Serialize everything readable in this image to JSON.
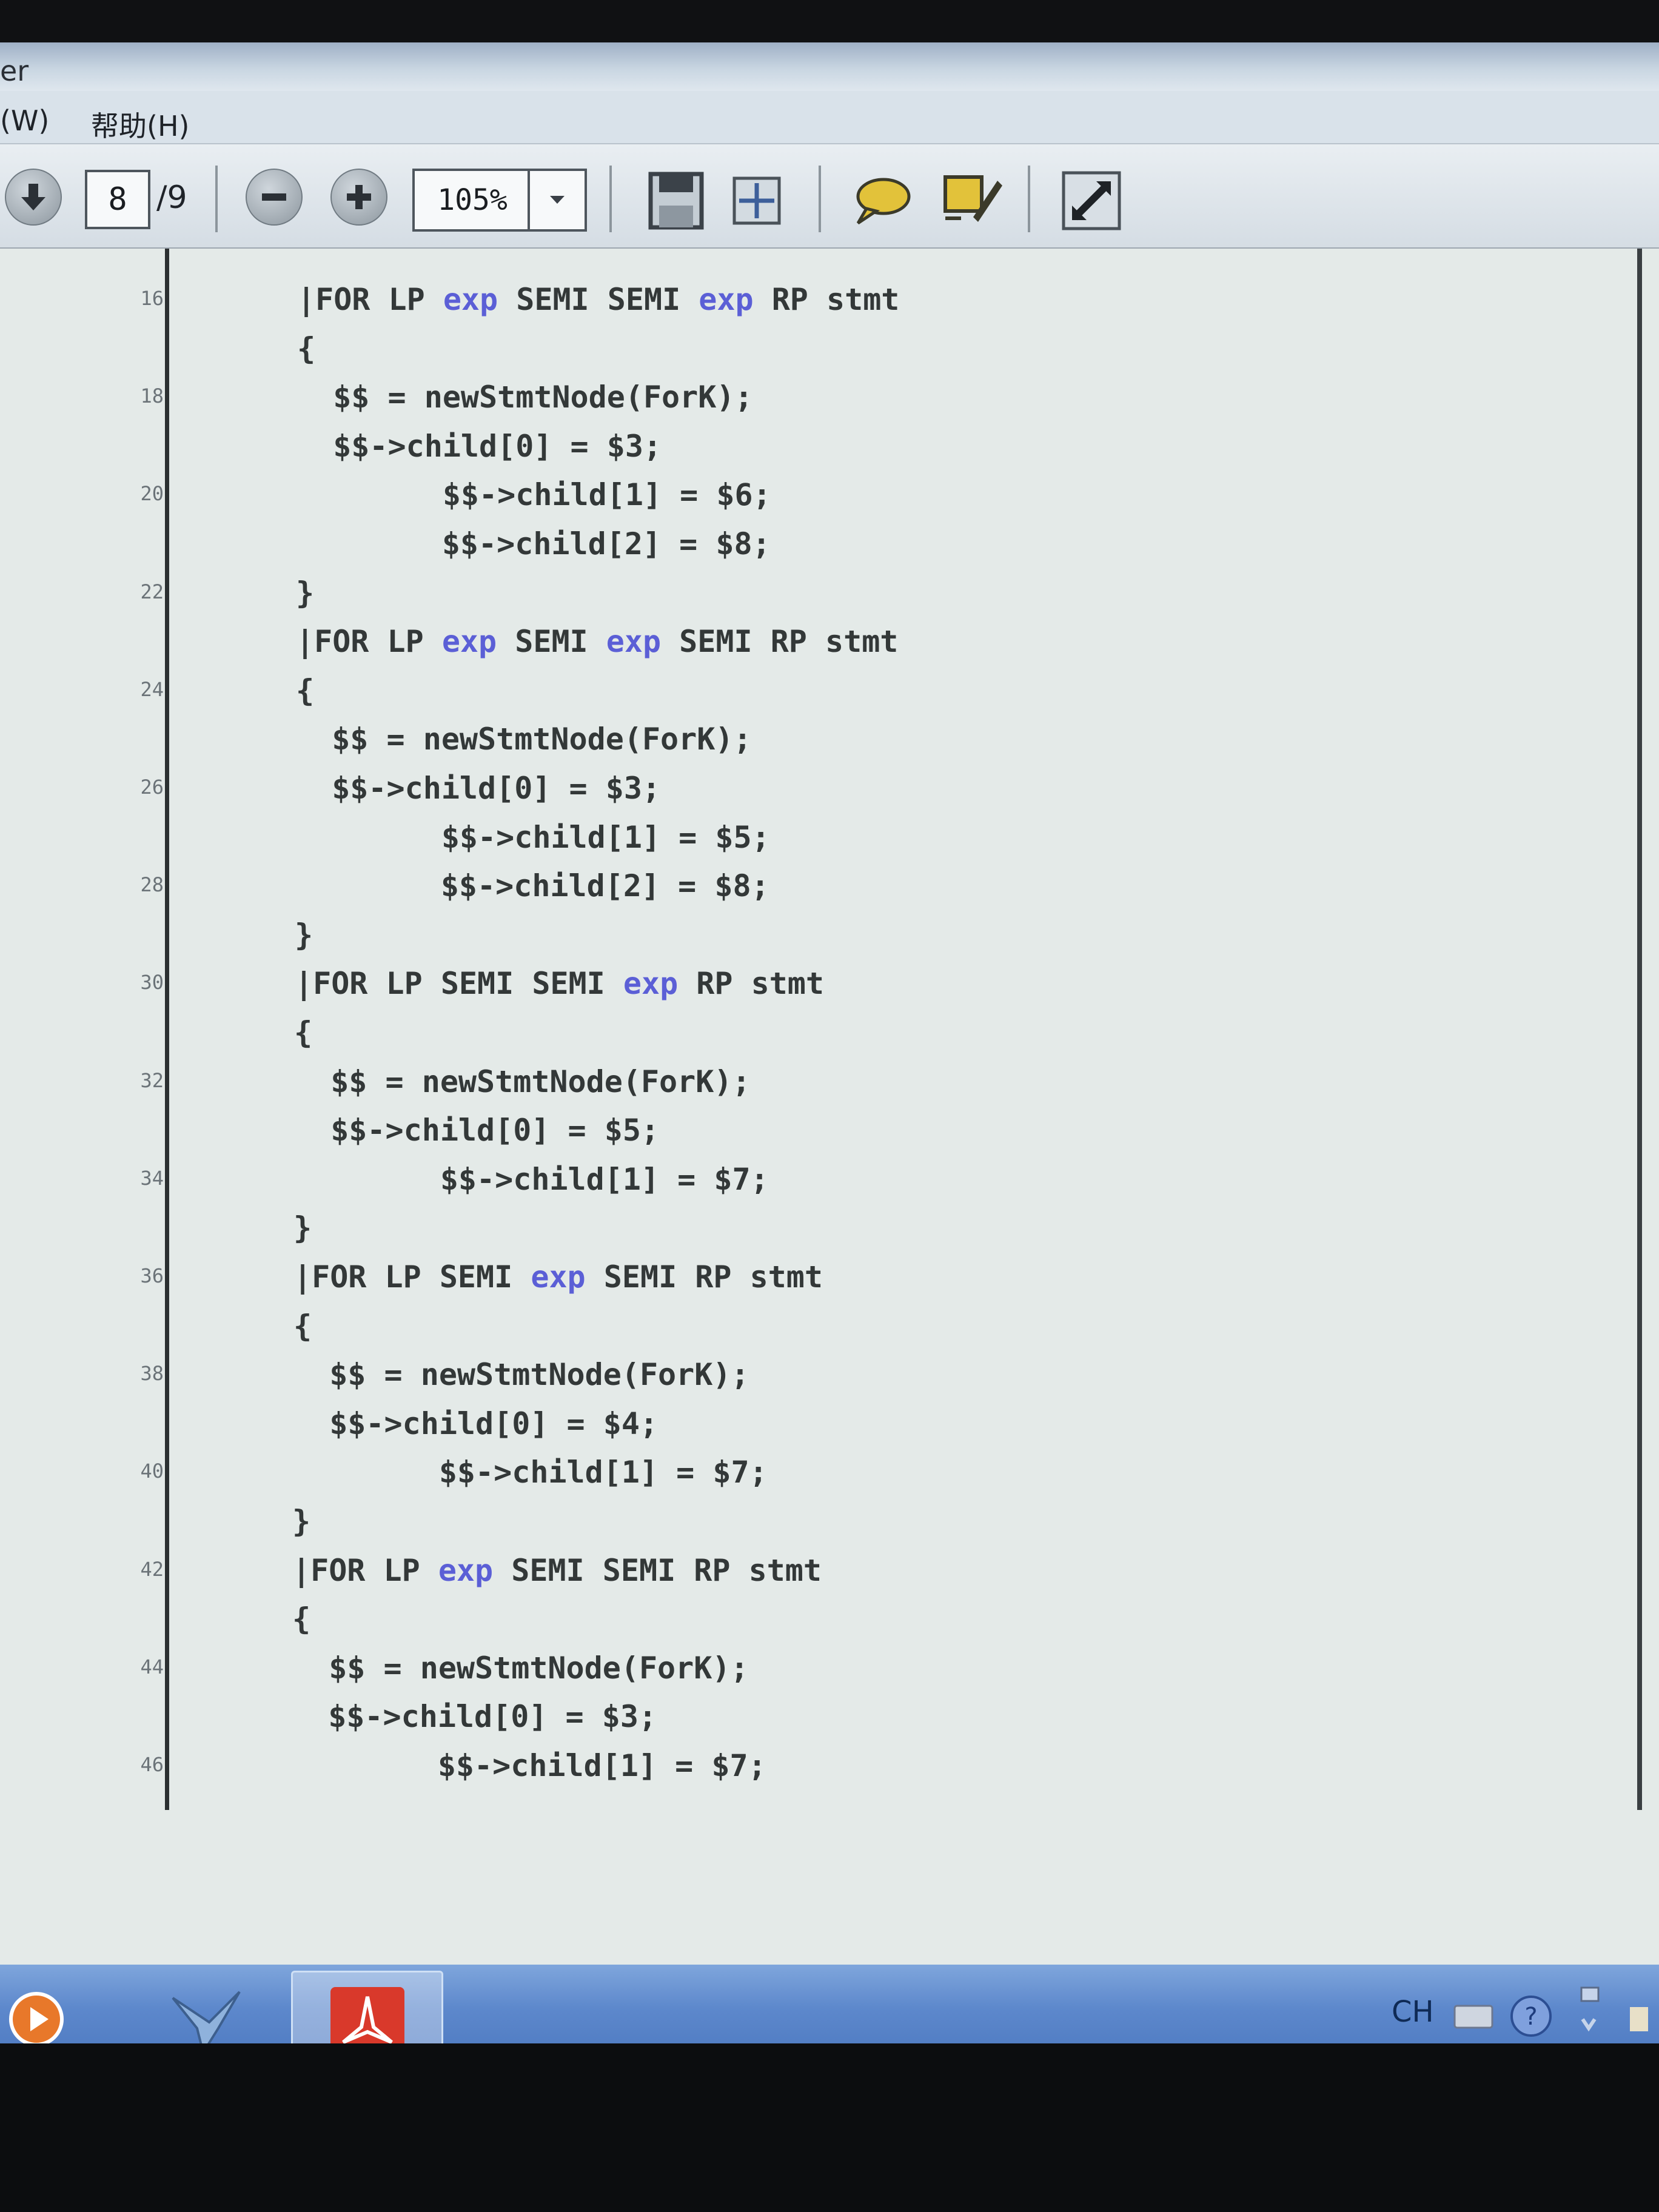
{
  "window": {
    "title_fragment": "er"
  },
  "menu": {
    "items": [
      "(W)",
      "帮助(H)"
    ]
  },
  "toolbar": {
    "page_current": "8",
    "page_total": "/9",
    "zoom": "105%",
    "icons": [
      "arrow-down-icon",
      "zoom-out-icon",
      "zoom-in-icon",
      "dropdown-icon",
      "fit-page-icon",
      "fit-width-icon",
      "comment-icon",
      "sign-icon",
      "expand-icon"
    ]
  },
  "document": {
    "keyword_color": "#5b5fd6",
    "line_numbers": [
      "16",
      "18",
      "20",
      "22",
      "24",
      "26",
      "28",
      "30",
      "32",
      "34",
      "36",
      "38",
      "40",
      "42",
      "44",
      "46"
    ],
    "lines": [
      [
        {
          "t": "|FOR LP "
        },
        {
          "t": "exp",
          "k": 1
        },
        {
          "t": " SEMI SEMI "
        },
        {
          "t": "exp",
          "k": 1
        },
        {
          "t": " RP stmt"
        }
      ],
      [
        {
          "t": "{"
        }
      ],
      [
        {
          "t": "  $$ = newStmtNode(ForK);"
        }
      ],
      [
        {
          "t": "  $$->child[0] = $3;"
        }
      ],
      [
        {
          "t": "        $$->child[1] = $6;"
        }
      ],
      [
        {
          "t": "        $$->child[2] = $8;"
        }
      ],
      [
        {
          "t": "}"
        }
      ],
      [
        {
          "t": "|FOR LP "
        },
        {
          "t": "exp",
          "k": 1
        },
        {
          "t": " SEMI "
        },
        {
          "t": "exp",
          "k": 1
        },
        {
          "t": " SEMI RP stmt"
        }
      ],
      [
        {
          "t": "{"
        }
      ],
      [
        {
          "t": "  $$ = newStmtNode(ForK);"
        }
      ],
      [
        {
          "t": "  $$->child[0] = $3;"
        }
      ],
      [
        {
          "t": "        $$->child[1] = $5;"
        }
      ],
      [
        {
          "t": "        $$->child[2] = $8;"
        }
      ],
      [
        {
          "t": "}"
        }
      ],
      [
        {
          "t": "|FOR LP SEMI SEMI "
        },
        {
          "t": "exp",
          "k": 1
        },
        {
          "t": " RP stmt"
        }
      ],
      [
        {
          "t": "{"
        }
      ],
      [
        {
          "t": "  $$ = newStmtNode(ForK);"
        }
      ],
      [
        {
          "t": "  $$->child[0] = $5;"
        }
      ],
      [
        {
          "t": "        $$->child[1] = $7;"
        }
      ],
      [
        {
          "t": "}"
        }
      ],
      [
        {
          "t": "|FOR LP SEMI "
        },
        {
          "t": "exp",
          "k": 1
        },
        {
          "t": " SEMI RP stmt"
        }
      ],
      [
        {
          "t": "{"
        }
      ],
      [
        {
          "t": "  $$ = newStmtNode(ForK);"
        }
      ],
      [
        {
          "t": "  $$->child[0] = $4;"
        }
      ],
      [
        {
          "t": "        $$->child[1] = $7;"
        }
      ],
      [
        {
          "t": "}"
        }
      ],
      [
        {
          "t": "|FOR LP "
        },
        {
          "t": "exp",
          "k": 1
        },
        {
          "t": " SEMI SEMI RP stmt"
        }
      ],
      [
        {
          "t": "{"
        }
      ],
      [
        {
          "t": "  $$ = newStmtNode(ForK);"
        }
      ],
      [
        {
          "t": "  $$->child[0] = $3;"
        }
      ],
      [
        {
          "t": "        $$->child[1] = $7;"
        }
      ]
    ]
  },
  "taskbar": {
    "apps": [
      "media-player-icon",
      "bird-app-icon",
      "pdf-reader-icon"
    ],
    "tray": {
      "lang": "CH"
    }
  }
}
